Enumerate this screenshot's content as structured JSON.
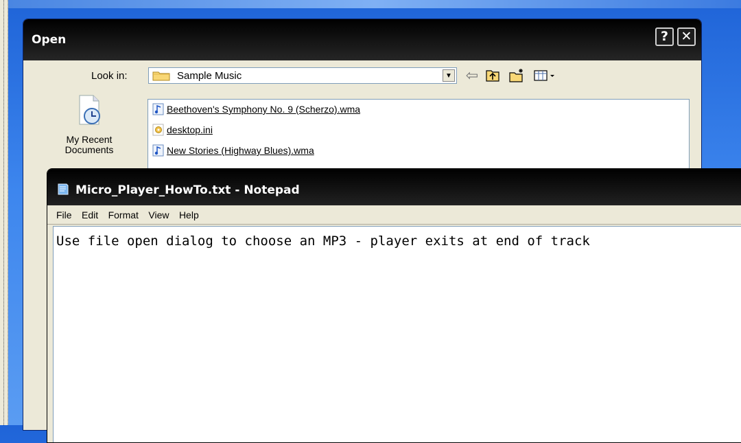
{
  "open_dialog": {
    "title": "Open",
    "help_button": "?",
    "close_button": "✕",
    "look_in_label": "Look in:",
    "look_in_value": "Sample Music",
    "places": [
      {
        "label": "My Recent\nDocuments",
        "icon": "recent-documents-icon"
      }
    ],
    "files": [
      {
        "name": "Beethoven's Symphony No. 9 (Scherzo).wma",
        "icon": "music-file-icon"
      },
      {
        "name": "desktop.ini",
        "icon": "settings-file-icon"
      },
      {
        "name": "New Stories (Highway Blues).wma",
        "icon": "music-file-icon"
      }
    ],
    "toolbar": {
      "back_icon": "back-arrow-icon",
      "up_icon": "up-folder-icon",
      "new_folder_icon": "new-folder-icon",
      "views_icon": "views-menu-icon"
    }
  },
  "notepad": {
    "title": "Micro_Player_HowTo.txt - Notepad",
    "menu": [
      "File",
      "Edit",
      "Format",
      "View",
      "Help"
    ],
    "content": "Use file open dialog to choose an MP3 - player exits at end of track"
  },
  "colors": {
    "titlebar": "#000000",
    "dialog_bg": "#ece9d8",
    "desktop": "#3d86ee",
    "field_border": "#7f9db9"
  }
}
